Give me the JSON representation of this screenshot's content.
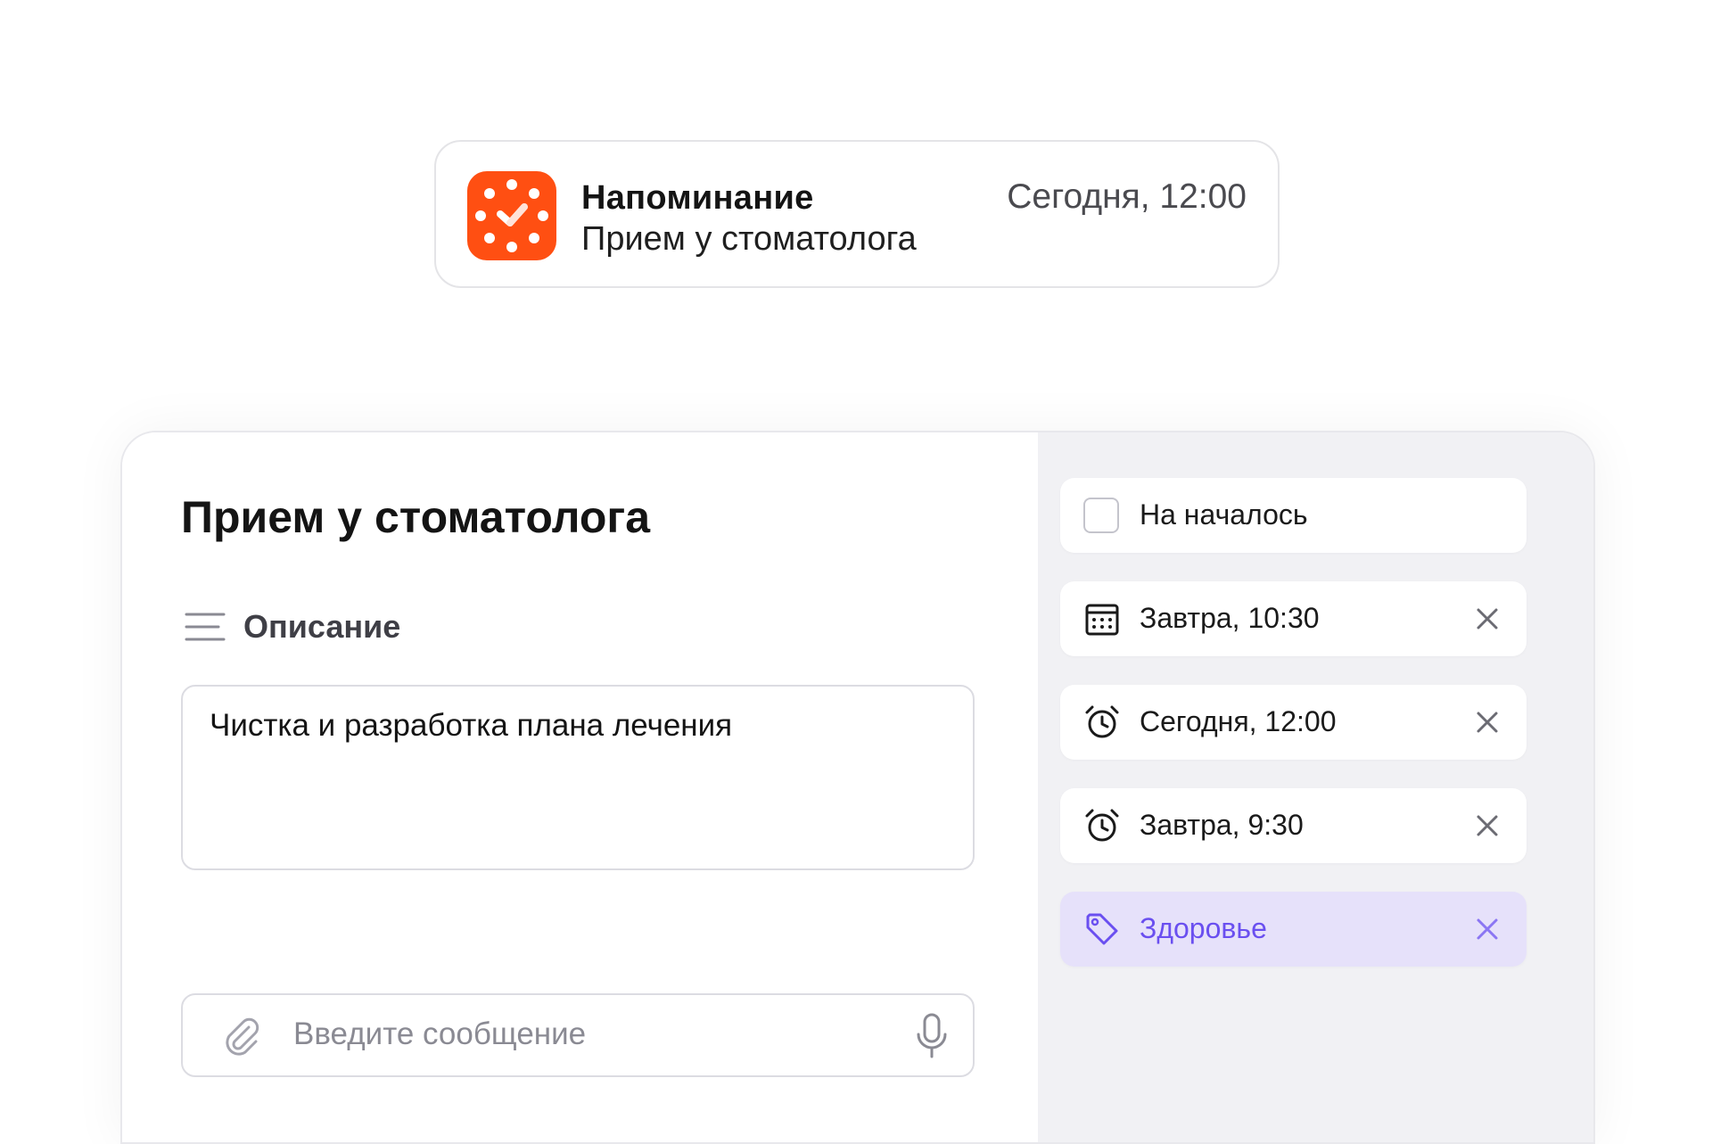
{
  "notification": {
    "app_name": "Напоминание",
    "message": "Прием у стоматолога",
    "time": "Сегодня, 12:00",
    "logo_color": "#ff4f12"
  },
  "task": {
    "title": "Прием у стоматолога",
    "description_label": "Описание",
    "description_text": "Чистка и разработка плана лечения",
    "message_placeholder": "Введите сообщение"
  },
  "options": {
    "start": {
      "label": "На началось",
      "checked": false
    },
    "due": {
      "label": "Завтра, 10:30",
      "icon": "calendar-icon"
    },
    "reminder1": {
      "label": "Сегодня, 12:00",
      "icon": "alarm-clock-icon"
    },
    "reminder2": {
      "label": "Завтра, 9:30",
      "icon": "alarm-clock-icon"
    },
    "tag": {
      "label": "Здоровье",
      "icon": "tag-icon",
      "color": "#6a4ff0",
      "background": "#e6e1fa"
    }
  }
}
